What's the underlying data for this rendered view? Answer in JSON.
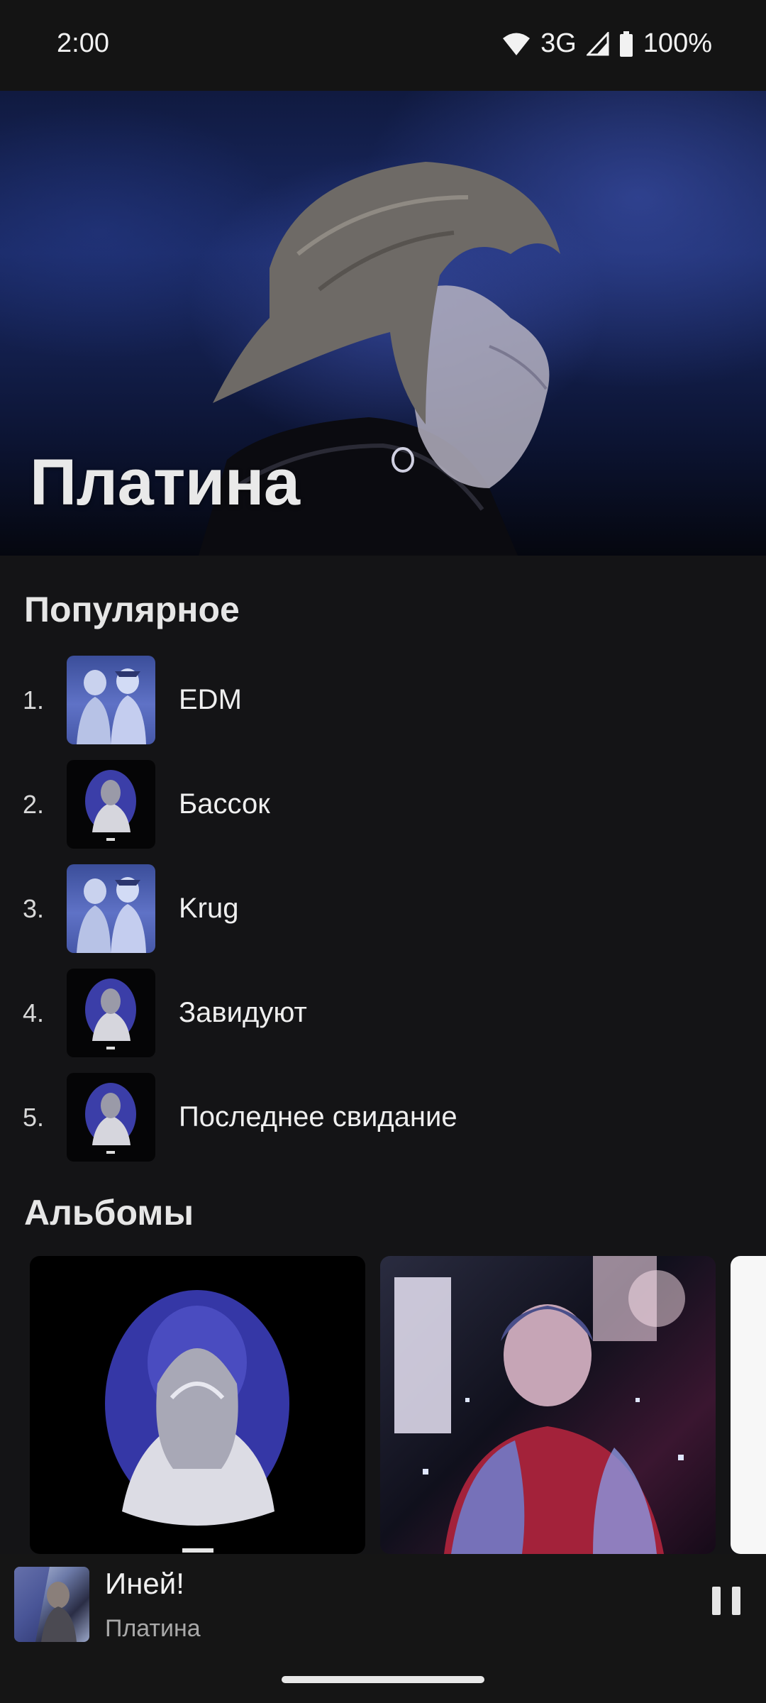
{
  "status_bar": {
    "time": "2:00",
    "network": "3G",
    "battery": "100%",
    "icons": [
      "wifi-icon",
      "cell-signal-icon",
      "battery-icon"
    ]
  },
  "artist": {
    "name": "Платина"
  },
  "popular": {
    "heading": "Популярное",
    "tracks": [
      {
        "num": "1.",
        "title": "EDM",
        "cover": "edm-cover"
      },
      {
        "num": "2.",
        "title": "Бассок",
        "cover": "dark-oval-cover"
      },
      {
        "num": "3.",
        "title": "Krug",
        "cover": "edm-cover"
      },
      {
        "num": "4.",
        "title": "Завидуют",
        "cover": "dark-oval-cover"
      },
      {
        "num": "5.",
        "title": "Последнее свидание",
        "cover": "dark-oval-cover"
      }
    ]
  },
  "albums": {
    "heading": "Альбомы",
    "cards": [
      "album-dark-oval",
      "album-neon-jacket",
      "album-white"
    ]
  },
  "now_playing": {
    "title": "Иней!",
    "artist": "Платина",
    "state": "playing"
  },
  "colors": {
    "background": "#141416",
    "hero_blue": "#1a2a66",
    "text": "#ececec",
    "muted": "#a9a9a9"
  }
}
